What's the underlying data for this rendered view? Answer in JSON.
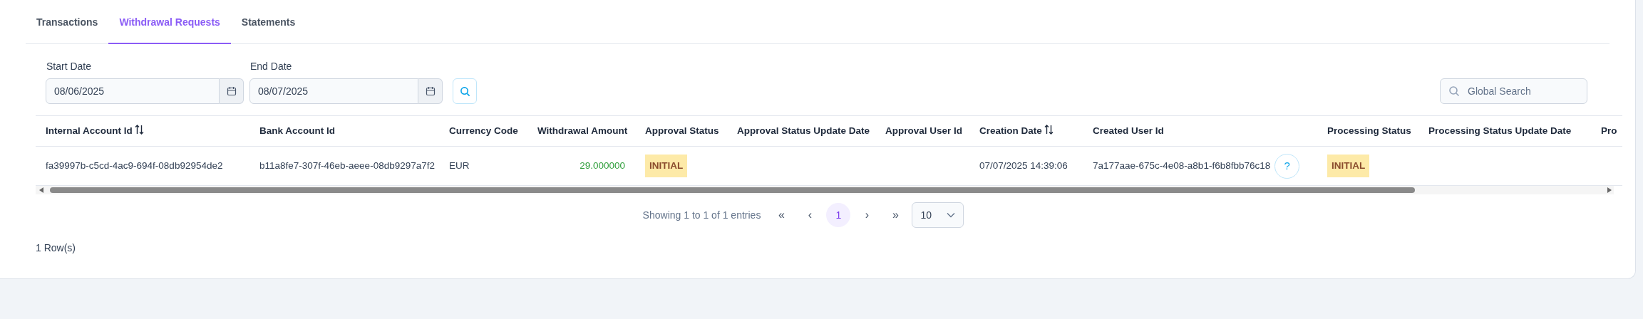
{
  "tabs": [
    {
      "label": "Transactions",
      "selected": false
    },
    {
      "label": "Withdrawal Requests",
      "selected": true
    },
    {
      "label": "Statements",
      "selected": false
    }
  ],
  "filters": {
    "start_date": {
      "label": "Start Date",
      "value": "08/06/2025"
    },
    "end_date": {
      "label": "End Date",
      "value": "08/07/2025"
    }
  },
  "global_search": {
    "placeholder": "Global Search"
  },
  "table": {
    "columns": [
      {
        "label": "Internal Account Id",
        "sortable": true
      },
      {
        "label": "Bank Account Id",
        "sortable": false
      },
      {
        "label": "Currency Code",
        "sortable": false
      },
      {
        "label": "Withdrawal Amount",
        "sortable": false
      },
      {
        "label": "Approval Status",
        "sortable": false
      },
      {
        "label": "Approval Status Update Date",
        "sortable": false
      },
      {
        "label": "Approval User Id",
        "sortable": false
      },
      {
        "label": "Creation Date",
        "sortable": true
      },
      {
        "label": "Created User Id",
        "sortable": false
      },
      {
        "label": "Processing Status",
        "sortable": false
      },
      {
        "label": "Processing Status Update Date",
        "sortable": false
      },
      {
        "label": "Pro",
        "sortable": false
      }
    ],
    "rows": [
      {
        "cells": [
          {
            "kind": "text",
            "text": "fa39997b-c5cd-4ac9-694f-08db92954de2"
          },
          {
            "kind": "text",
            "text": "b11a8fe7-307f-46eb-aeee-08db9297a7f2"
          },
          {
            "kind": "text",
            "text": "EUR"
          },
          {
            "kind": "amount",
            "text": "29.000000"
          },
          {
            "kind": "badge",
            "text": "INITIAL"
          },
          {
            "kind": "empty"
          },
          {
            "kind": "empty"
          },
          {
            "kind": "text",
            "text": "07/07/2025 14:39:06"
          },
          {
            "kind": "user",
            "text": "7a177aae-675c-4e08-a8b1-f6b8fbb76c18",
            "help": "?"
          },
          {
            "kind": "badge",
            "text": "INITIAL"
          },
          {
            "kind": "empty"
          },
          {
            "kind": "empty"
          }
        ]
      }
    ]
  },
  "pagination": {
    "summary": "Showing 1 to 1 of 1 entries",
    "first": "«",
    "prev": "‹",
    "pages": [
      {
        "label": "1",
        "selected": true
      }
    ],
    "next": "›",
    "last": "»",
    "page_size": "10"
  },
  "row_count": "1 Row(s)"
}
